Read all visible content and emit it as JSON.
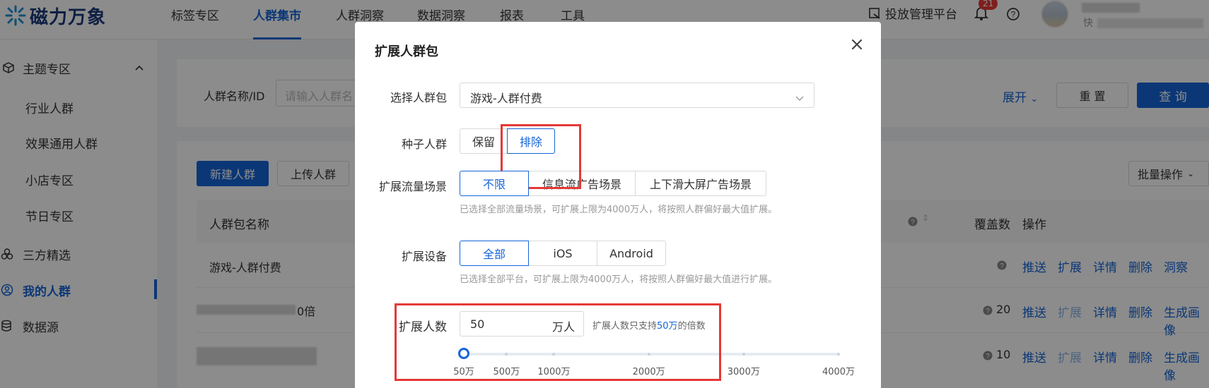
{
  "brand": {
    "name": "磁力万象"
  },
  "nav": [
    {
      "label": "标签专区"
    },
    {
      "label": "人群集市"
    },
    {
      "label": "人群洞察"
    },
    {
      "label": "数据洞察"
    },
    {
      "label": "报表"
    },
    {
      "label": "工具"
    }
  ],
  "header_right": {
    "platform_link": "投放管理平台",
    "notification_count": "21",
    "user_sub": "快"
  },
  "sidebar": {
    "section_title": "主题专区",
    "sub_items": [
      "行业人群",
      "效果通用人群",
      "小店专区",
      "节日专区"
    ],
    "items": [
      "三方精选",
      "我的人群",
      "数据源"
    ]
  },
  "filter": {
    "label": "人群名称/ID",
    "placeholder": "请输入人群名",
    "expand": "展开",
    "reset": "重 置",
    "query": "查 询"
  },
  "toolbar": {
    "new": "新建人群",
    "upload": "上传人群",
    "batch": "批量操作"
  },
  "table": {
    "col_name": "人群包名称",
    "col_cover": "覆盖数",
    "col_ops": "操作",
    "rows": [
      {
        "name": "游戏-人群付费",
        "cover": "",
        "ops": [
          "推送",
          "扩展",
          "详情",
          "删除",
          "洞察"
        ]
      },
      {
        "name": "0倍",
        "cover": "20",
        "ops": [
          "推送",
          "扩展",
          "详情",
          "删除",
          "生成画像"
        ]
      },
      {
        "name": "",
        "cover": "10",
        "ops": [
          "推送",
          "扩展",
          "详情",
          "删除",
          "生成画像"
        ]
      }
    ]
  },
  "modal": {
    "title": "扩展人群包",
    "select_label": "选择人群包",
    "select_value": "游戏-人群付费",
    "seed_label": "种子人群",
    "seed_options": [
      "保留",
      "排除"
    ],
    "seed_selected": "排除",
    "scene_label": "扩展流量场景",
    "scene_options": [
      "不限",
      "信息流广告场景",
      "上下滑大屏广告场景"
    ],
    "scene_selected": "不限",
    "scene_hint": "已选择全部流量场景，可扩展上限为4000万人，将按照人群偏好最大值扩展。",
    "device_label": "扩展设备",
    "device_options": [
      "全部",
      "iOS",
      "Android"
    ],
    "device_selected": "全部",
    "device_hint": "已选择全部平台，可扩展上限为4000万人，将按照人群偏好最大值进行扩展。",
    "count_label": "扩展人数",
    "count_value": "50",
    "count_unit": "万人",
    "count_hint_prefix": "扩展人数只支持",
    "count_hint_highlight": "50万",
    "count_hint_suffix": "的倍数",
    "slider": {
      "min": 50,
      "max": 4000,
      "value": 50,
      "ticks": [
        "50万",
        "500万",
        "1000万",
        "2000万",
        "3000万",
        "4000万"
      ],
      "tick_values": [
        50,
        500,
        1000,
        2000,
        3000,
        4000
      ]
    }
  },
  "colors": {
    "primary": "#1565d8",
    "highlight_box": "#e53935"
  }
}
